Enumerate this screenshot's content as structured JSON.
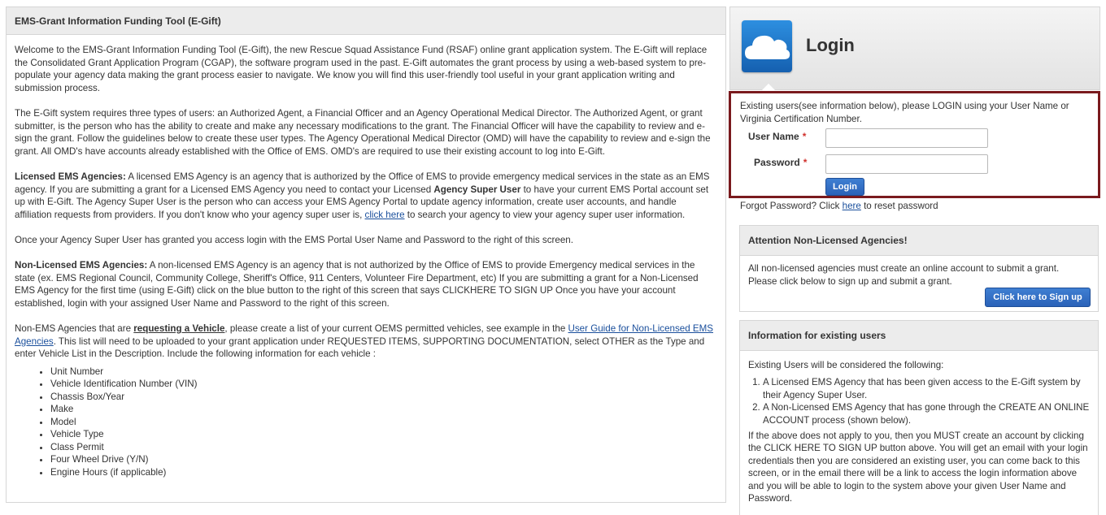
{
  "left_panel": {
    "title": "EMS-Grant Information Funding Tool (E-Gift)",
    "p1": "Welcome to the EMS-Grant Information Funding Tool (E-Gift), the new Rescue Squad Assistance Fund (RSAF) online grant application system. The E-Gift will replace the Consolidated Grant Application Program (CGAP), the software program used in the past. E-Gift automates the grant process by using a web-based system to pre-populate your agency data making the grant process easier to navigate. We know you will find this user-friendly tool useful in your grant application writing and submission process.",
    "p2": "The E-Gift system requires three types of users: an Authorized Agent, a Financial Officer and an Agency Operational Medical Director. The Authorized Agent, or grant submitter, is the person who has the ability to create and make any necessary modifications to the grant. The Financial Officer will have the capability to review and e-sign the grant. Follow the guidelines below to create these user types. The Agency Operational Medical Director (OMD) will have the capability to review and e-sign the grant. All OMD's have accounts already established with the Office of EMS. OMD's are required to use their existing account to log into E-Gift.",
    "p3_bold": "Licensed EMS Agencies:",
    "p3_a": " A licensed EMS Agency is an agency that is authorized by the Office of EMS to provide emergency medical services in the state as an EMS agency. If you are submitting a grant for a Licensed EMS Agency you need to contact your Licensed ",
    "p3_bold2": "Agency Super User",
    "p3_b": " to have your current EMS Portal account set up with E-Gift. The Agency Super User is the person who can access your EMS Agency Portal to update agency information, create user accounts, and handle affiliation requests from providers. If you don't know who your agency super user is, ",
    "p3_link": "click here",
    "p3_c": " to search your agency to view your agency super user information.",
    "p4": "Once your Agency Super User has granted you access login with the EMS Portal User Name and Password to the right of this screen.",
    "p5_bold": "Non-Licensed EMS Agencies:",
    "p5": " A non-licensed EMS Agency is an agency that is not authorized by the Office of EMS to provide Emergency medical services in the state (ex. EMS Regional Council, Community College, Sheriff's Office, 911 Centers, Volunteer Fire Department, etc) If you are submitting a grant for a Non-Licensed EMS Agency for the first time (using E-Gift) click on the blue button to the right of this screen that says CLICKHERE TO SIGN UP Once you have your account established, login with your assigned User Name and Password to the right of this screen.",
    "p6_a": "Non-EMS Agencies that are ",
    "p6_bold": "requesting a Vehicle",
    "p6_b": ", please create a list of your current OEMS permitted vehicles, see example in the ",
    "p6_link": "User Guide for Non-Licensed EMS Agencies",
    "p6_c": ". This list will need to be uploaded to your grant application under REQUESTED ITEMS, SUPPORTING DOCUMENTATION, select OTHER as the Type and enter Vehicle List in the Description. Include the following information for each vehicle :",
    "vehicle_items": [
      "Unit Number",
      "Vehicle Identification Number (VIN)",
      "Chassis Box/Year",
      "Make",
      "Model",
      "Vehicle Type",
      "Class Permit",
      "Four Wheel Drive (Y/N)",
      "Engine Hours (if applicable)"
    ]
  },
  "login": {
    "title": "Login",
    "icon": "cloud-icon",
    "intro": "Existing users(see information below), please LOGIN using your User Name or Virginia Certification Number.",
    "username_label": "User Name",
    "password_label": "Password",
    "required_mark": "*",
    "username_value": "",
    "password_value": "",
    "button": "Login",
    "forgot_a": "Forgot Password? Click ",
    "forgot_link": "here",
    "forgot_b": " to reset password"
  },
  "attention": {
    "title": "Attention Non-Licensed Agencies!",
    "text": "All non-licensed agencies must create an online account to submit a grant. Please click below to sign up and submit a grant.",
    "button": "Click here to Sign up"
  },
  "info": {
    "title": "Information for existing users",
    "lead": "Existing Users will be considered the following:",
    "items": [
      "A Licensed EMS Agency that has been given access to the E-Gift system by their Agency Super User.",
      "A Non-Licensed EMS Agency that has gone through the CREATE AN ONLINE ACCOUNT process (shown below)."
    ],
    "text": "If the above does not apply to you, then you MUST create an account by clicking the CLICK HERE TO SIGN UP button above. You will get an email with your login credentials then you are considered an existing user, you can come back to this screen, or in the email there will be a link to access the login information above and you will be able to login to the system above your given User Name and Password."
  },
  "colors": {
    "login_box_border": "#7a1a1e",
    "button_blue": "#2a62b8",
    "required_red": "#d0312d",
    "link_blue": "#1a4f9c"
  }
}
